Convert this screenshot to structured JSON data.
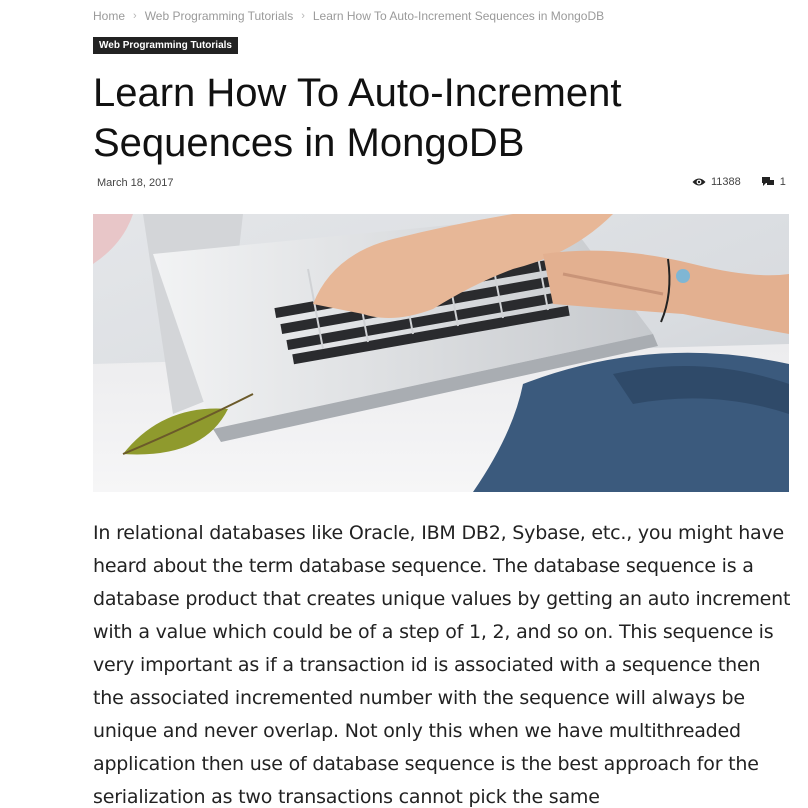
{
  "breadcrumb": {
    "items": [
      "Home",
      "Web Programming Tutorials",
      "Learn How To Auto-Increment Sequences in MongoDB"
    ],
    "separator": "›"
  },
  "category": {
    "label": "Web Programming Tutorials"
  },
  "article": {
    "title": "Learn How To Auto-Increment Sequences in MongoDB",
    "date": "March 18, 2017",
    "views": "11388",
    "comments": "1",
    "body": "In relational databases like Oracle, IBM DB2, Sybase, etc., you might have heard about the term database sequence. The database sequence is a database product that creates unique values by getting an auto increment with a value which could be of a step of 1, 2, and so on. This sequence is very important as if a transaction id is associated with a sequence then the associated incremented number with the sequence will always be unique and never overlap. Not only this when we have multithreaded application then use of database sequence is the best approach for the serialization as two transactions cannot pick the same"
  },
  "icons": {
    "views": "eye-icon",
    "comments": "comment-icon"
  },
  "colors": {
    "badge_bg": "#222222",
    "breadcrumb_text": "#9a9a9a",
    "title_text": "#111111"
  }
}
